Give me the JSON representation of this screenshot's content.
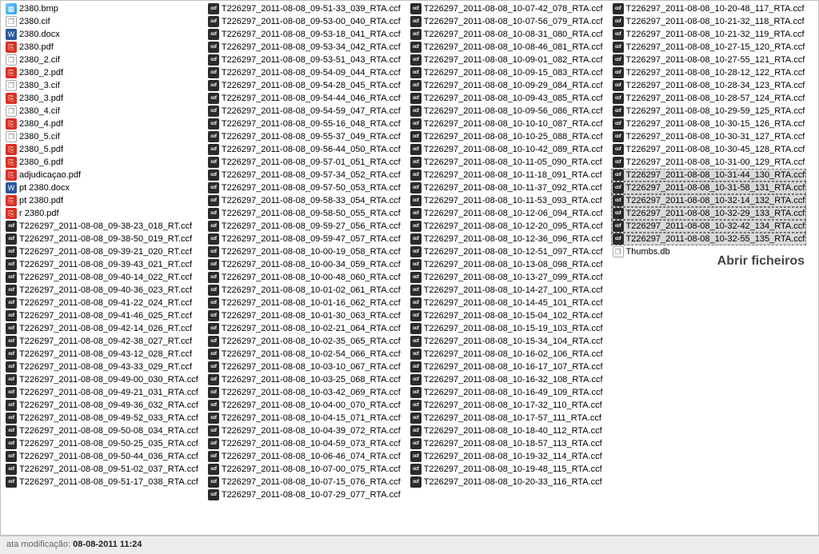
{
  "callout_text": "Abrir ficheiros",
  "status": {
    "label": "ata modificação:",
    "value": "08-08-2011 11:24"
  },
  "icon_glyphs": {
    "ccf": "ccf",
    "bmp": "▦",
    "cif": "❐",
    "docx": "W",
    "pdf": "⎘",
    "db": "❐"
  },
  "selected_start": "T226297_2011-08-08_10-31-44_130_RTA.ccf",
  "selected_end": "T226297_2011-08-08_10-32-55_135_RTA.ccf",
  "columns": [
    [
      {
        "name": "2380.bmp",
        "type": "bmp"
      },
      {
        "name": "2380.cif",
        "type": "cif"
      },
      {
        "name": "2380.docx",
        "type": "docx"
      },
      {
        "name": "2380.pdf",
        "type": "pdf"
      },
      {
        "name": "2380_2.cif",
        "type": "cif"
      },
      {
        "name": "2380_2.pdf",
        "type": "pdf"
      },
      {
        "name": "2380_3.cif",
        "type": "cif"
      },
      {
        "name": "2380_3.pdf",
        "type": "pdf"
      },
      {
        "name": "2380_4.cif",
        "type": "cif"
      },
      {
        "name": "2380_4.pdf",
        "type": "pdf"
      },
      {
        "name": "2380_5.cif",
        "type": "cif"
      },
      {
        "name": "2380_5.pdf",
        "type": "pdf"
      },
      {
        "name": "2380_6.pdf",
        "type": "pdf"
      },
      {
        "name": "adjudicaçao.pdf",
        "type": "pdf"
      },
      {
        "name": "pt 2380.docx",
        "type": "docx"
      },
      {
        "name": "pt 2380.pdf",
        "type": "pdf"
      },
      {
        "name": "r 2380.pdf",
        "type": "pdf"
      },
      {
        "name": "T226297_2011-08-08_09-38-23_018_RT.ccf",
        "type": "ccf"
      },
      {
        "name": "T226297_2011-08-08_09-38-50_019_RT.ccf",
        "type": "ccf"
      },
      {
        "name": "T226297_2011-08-08_09-39-21_020_RT.ccf",
        "type": "ccf"
      },
      {
        "name": "T226297_2011-08-08_09-39-43_021_RT.ccf",
        "type": "ccf"
      },
      {
        "name": "T226297_2011-08-08_09-40-14_022_RT.ccf",
        "type": "ccf"
      },
      {
        "name": "T226297_2011-08-08_09-40-36_023_RT.ccf",
        "type": "ccf"
      },
      {
        "name": "T226297_2011-08-08_09-41-22_024_RT.ccf",
        "type": "ccf"
      },
      {
        "name": "T226297_2011-08-08_09-41-46_025_RT.ccf",
        "type": "ccf"
      },
      {
        "name": "T226297_2011-08-08_09-42-14_026_RT.ccf",
        "type": "ccf"
      },
      {
        "name": "T226297_2011-08-08_09-42-38_027_RT.ccf",
        "type": "ccf"
      },
      {
        "name": "T226297_2011-08-08_09-43-12_028_RT.ccf",
        "type": "ccf"
      },
      {
        "name": "T226297_2011-08-08_09-43-33_029_RT.ccf",
        "type": "ccf"
      },
      {
        "name": "T226297_2011-08-08_09-49-00_030_RTA.ccf",
        "type": "ccf"
      },
      {
        "name": "T226297_2011-08-08_09-49-21_031_RTA.ccf",
        "type": "ccf"
      },
      {
        "name": "T226297_2011-08-08_09-49-36_032_RTA.ccf",
        "type": "ccf"
      },
      {
        "name": "T226297_2011-08-08_09-49-52_033_RTA.ccf",
        "type": "ccf"
      },
      {
        "name": "T226297_2011-08-08_09-50-08_034_RTA.ccf",
        "type": "ccf"
      },
      {
        "name": "T226297_2011-08-08_09-50-25_035_RTA.ccf",
        "type": "ccf"
      },
      {
        "name": "T226297_2011-08-08_09-50-44_036_RTA.ccf",
        "type": "ccf"
      },
      {
        "name": "T226297_2011-08-08_09-51-02_037_RTA.ccf",
        "type": "ccf"
      },
      {
        "name": "T226297_2011-08-08_09-51-17_038_RTA.ccf",
        "type": "ccf"
      }
    ],
    [
      {
        "name": "T226297_2011-08-08_09-51-33_039_RTA.ccf",
        "type": "ccf"
      },
      {
        "name": "T226297_2011-08-08_09-53-00_040_RTA.ccf",
        "type": "ccf"
      },
      {
        "name": "T226297_2011-08-08_09-53-18_041_RTA.ccf",
        "type": "ccf"
      },
      {
        "name": "T226297_2011-08-08_09-53-34_042_RTA.ccf",
        "type": "ccf"
      },
      {
        "name": "T226297_2011-08-08_09-53-51_043_RTA.ccf",
        "type": "ccf"
      },
      {
        "name": "T226297_2011-08-08_09-54-09_044_RTA.ccf",
        "type": "ccf"
      },
      {
        "name": "T226297_2011-08-08_09-54-28_045_RTA.ccf",
        "type": "ccf"
      },
      {
        "name": "T226297_2011-08-08_09-54-44_046_RTA.ccf",
        "type": "ccf"
      },
      {
        "name": "T226297_2011-08-08_09-54-59_047_RTA.ccf",
        "type": "ccf"
      },
      {
        "name": "T226297_2011-08-08_09-55-16_048_RTA.ccf",
        "type": "ccf"
      },
      {
        "name": "T226297_2011-08-08_09-55-37_049_RTA.ccf",
        "type": "ccf"
      },
      {
        "name": "T226297_2011-08-08_09-56-44_050_RTA.ccf",
        "type": "ccf"
      },
      {
        "name": "T226297_2011-08-08_09-57-01_051_RTA.ccf",
        "type": "ccf"
      },
      {
        "name": "T226297_2011-08-08_09-57-34_052_RTA.ccf",
        "type": "ccf"
      },
      {
        "name": "T226297_2011-08-08_09-57-50_053_RTA.ccf",
        "type": "ccf"
      },
      {
        "name": "T226297_2011-08-08_09-58-33_054_RTA.ccf",
        "type": "ccf"
      },
      {
        "name": "T226297_2011-08-08_09-58-50_055_RTA.ccf",
        "type": "ccf"
      },
      {
        "name": "T226297_2011-08-08_09-59-27_056_RTA.ccf",
        "type": "ccf"
      },
      {
        "name": "T226297_2011-08-08_09-59-47_057_RTA.ccf",
        "type": "ccf"
      },
      {
        "name": "T226297_2011-08-08_10-00-19_058_RTA.ccf",
        "type": "ccf"
      },
      {
        "name": "T226297_2011-08-08_10-00-34_059_RTA.ccf",
        "type": "ccf"
      },
      {
        "name": "T226297_2011-08-08_10-00-48_060_RTA.ccf",
        "type": "ccf"
      },
      {
        "name": "T226297_2011-08-08_10-01-02_061_RTA.ccf",
        "type": "ccf"
      },
      {
        "name": "T226297_2011-08-08_10-01-16_062_RTA.ccf",
        "type": "ccf"
      },
      {
        "name": "T226297_2011-08-08_10-01-30_063_RTA.ccf",
        "type": "ccf"
      },
      {
        "name": "T226297_2011-08-08_10-02-21_064_RTA.ccf",
        "type": "ccf"
      },
      {
        "name": "T226297_2011-08-08_10-02-35_065_RTA.ccf",
        "type": "ccf"
      },
      {
        "name": "T226297_2011-08-08_10-02-54_066_RTA.ccf",
        "type": "ccf"
      },
      {
        "name": "T226297_2011-08-08_10-03-10_067_RTA.ccf",
        "type": "ccf"
      },
      {
        "name": "T226297_2011-08-08_10-03-25_068_RTA.ccf",
        "type": "ccf"
      },
      {
        "name": "T226297_2011-08-08_10-03-42_069_RTA.ccf",
        "type": "ccf"
      },
      {
        "name": "T226297_2011-08-08_10-04-00_070_RTA.ccf",
        "type": "ccf"
      },
      {
        "name": "T226297_2011-08-08_10-04-15_071_RTA.ccf",
        "type": "ccf"
      },
      {
        "name": "T226297_2011-08-08_10-04-39_072_RTA.ccf",
        "type": "ccf"
      },
      {
        "name": "T226297_2011-08-08_10-04-59_073_RTA.ccf",
        "type": "ccf"
      },
      {
        "name": "T226297_2011-08-08_10-06-46_074_RTA.ccf",
        "type": "ccf"
      },
      {
        "name": "T226297_2011-08-08_10-07-00_075_RTA.ccf",
        "type": "ccf"
      },
      {
        "name": "T226297_2011-08-08_10-07-15_076_RTA.ccf",
        "type": "ccf"
      },
      {
        "name": "T226297_2011-08-08_10-07-29_077_RTA.ccf",
        "type": "ccf"
      }
    ],
    [
      {
        "name": "T226297_2011-08-08_10-07-42_078_RTA.ccf",
        "type": "ccf"
      },
      {
        "name": "T226297_2011-08-08_10-07-56_079_RTA.ccf",
        "type": "ccf"
      },
      {
        "name": "T226297_2011-08-08_10-08-31_080_RTA.ccf",
        "type": "ccf"
      },
      {
        "name": "T226297_2011-08-08_10-08-46_081_RTA.ccf",
        "type": "ccf"
      },
      {
        "name": "T226297_2011-08-08_10-09-01_082_RTA.ccf",
        "type": "ccf"
      },
      {
        "name": "T226297_2011-08-08_10-09-15_083_RTA.ccf",
        "type": "ccf"
      },
      {
        "name": "T226297_2011-08-08_10-09-29_084_RTA.ccf",
        "type": "ccf"
      },
      {
        "name": "T226297_2011-08-08_10-09-43_085_RTA.ccf",
        "type": "ccf"
      },
      {
        "name": "T226297_2011-08-08_10-09-56_086_RTA.ccf",
        "type": "ccf"
      },
      {
        "name": "T226297_2011-08-08_10-10-10_087_RTA.ccf",
        "type": "ccf"
      },
      {
        "name": "T226297_2011-08-08_10-10-25_088_RTA.ccf",
        "type": "ccf"
      },
      {
        "name": "T226297_2011-08-08_10-10-42_089_RTA.ccf",
        "type": "ccf"
      },
      {
        "name": "T226297_2011-08-08_10-11-05_090_RTA.ccf",
        "type": "ccf"
      },
      {
        "name": "T226297_2011-08-08_10-11-18_091_RTA.ccf",
        "type": "ccf"
      },
      {
        "name": "T226297_2011-08-08_10-11-37_092_RTA.ccf",
        "type": "ccf"
      },
      {
        "name": "T226297_2011-08-08_10-11-53_093_RTA.ccf",
        "type": "ccf"
      },
      {
        "name": "T226297_2011-08-08_10-12-06_094_RTA.ccf",
        "type": "ccf"
      },
      {
        "name": "T226297_2011-08-08_10-12-20_095_RTA.ccf",
        "type": "ccf"
      },
      {
        "name": "T226297_2011-08-08_10-12-36_096_RTA.ccf",
        "type": "ccf"
      },
      {
        "name": "T226297_2011-08-08_10-12-51_097_RTA.ccf",
        "type": "ccf"
      },
      {
        "name": "T226297_2011-08-08_10-13-08_098_RTA.ccf",
        "type": "ccf"
      },
      {
        "name": "T226297_2011-08-08_10-13-27_099_RTA.ccf",
        "type": "ccf"
      },
      {
        "name": "T226297_2011-08-08_10-14-27_100_RTA.ccf",
        "type": "ccf"
      },
      {
        "name": "T226297_2011-08-08_10-14-45_101_RTA.ccf",
        "type": "ccf"
      },
      {
        "name": "T226297_2011-08-08_10-15-04_102_RTA.ccf",
        "type": "ccf"
      },
      {
        "name": "T226297_2011-08-08_10-15-19_103_RTA.ccf",
        "type": "ccf"
      },
      {
        "name": "T226297_2011-08-08_10-15-34_104_RTA.ccf",
        "type": "ccf"
      },
      {
        "name": "T226297_2011-08-08_10-16-02_106_RTA.ccf",
        "type": "ccf"
      },
      {
        "name": "T226297_2011-08-08_10-16-17_107_RTA.ccf",
        "type": "ccf"
      },
      {
        "name": "T226297_2011-08-08_10-16-32_108_RTA.ccf",
        "type": "ccf"
      },
      {
        "name": "T226297_2011-08-08_10-16-49_109_RTA.ccf",
        "type": "ccf"
      },
      {
        "name": "T226297_2011-08-08_10-17-32_110_RTA.ccf",
        "type": "ccf"
      },
      {
        "name": "T226297_2011-08-08_10-17-57_111_RTA.ccf",
        "type": "ccf"
      },
      {
        "name": "T226297_2011-08-08_10-18-40_112_RTA.ccf",
        "type": "ccf"
      },
      {
        "name": "T226297_2011-08-08_10-18-57_113_RTA.ccf",
        "type": "ccf"
      },
      {
        "name": "T226297_2011-08-08_10-19-32_114_RTA.ccf",
        "type": "ccf"
      },
      {
        "name": "T226297_2011-08-08_10-19-48_115_RTA.ccf",
        "type": "ccf"
      },
      {
        "name": "T226297_2011-08-08_10-20-33_116_RTA.ccf",
        "type": "ccf"
      }
    ],
    [
      {
        "name": "T226297_2011-08-08_10-20-48_117_RTA.ccf",
        "type": "ccf"
      },
      {
        "name": "T226297_2011-08-08_10-21-32_118_RTA.ccf",
        "type": "ccf"
      },
      {
        "name": "T226297_2011-08-08_10-21-32_119_RTA.ccf",
        "type": "ccf"
      },
      {
        "name": "T226297_2011-08-08_10-27-15_120_RTA.ccf",
        "type": "ccf"
      },
      {
        "name": "T226297_2011-08-08_10-27-55_121_RTA.ccf",
        "type": "ccf"
      },
      {
        "name": "T226297_2011-08-08_10-28-12_122_RTA.ccf",
        "type": "ccf"
      },
      {
        "name": "T226297_2011-08-08_10-28-34_123_RTA.ccf",
        "type": "ccf"
      },
      {
        "name": "T226297_2011-08-08_10-28-57_124_RTA.ccf",
        "type": "ccf"
      },
      {
        "name": "T226297_2011-08-08_10-29-59_125_RTA.ccf",
        "type": "ccf"
      },
      {
        "name": "T226297_2011-08-08_10-30-15_126_RTA.ccf",
        "type": "ccf"
      },
      {
        "name": "T226297_2011-08-08_10-30-31_127_RTA.ccf",
        "type": "ccf"
      },
      {
        "name": "T226297_2011-08-08_10-30-45_128_RTA.ccf",
        "type": "ccf"
      },
      {
        "name": "T226297_2011-08-08_10-31-00_129_RTA.ccf",
        "type": "ccf"
      },
      {
        "name": "T226297_2011-08-08_10-31-44_130_RTA.ccf",
        "type": "ccf"
      },
      {
        "name": "T226297_2011-08-08_10-31-58_131_RTA.ccf",
        "type": "ccf"
      },
      {
        "name": "T226297_2011-08-08_10-32-14_132_RTA.ccf",
        "type": "ccf"
      },
      {
        "name": "T226297_2011-08-08_10-32-29_133_RTA.ccf",
        "type": "ccf"
      },
      {
        "name": "T226297_2011-08-08_10-32-42_134_RTA.ccf",
        "type": "ccf"
      },
      {
        "name": "T226297_2011-08-08_10-32-55_135_RTA.ccf",
        "type": "ccf"
      },
      {
        "name": "Thumbs.db",
        "type": "db"
      }
    ]
  ]
}
